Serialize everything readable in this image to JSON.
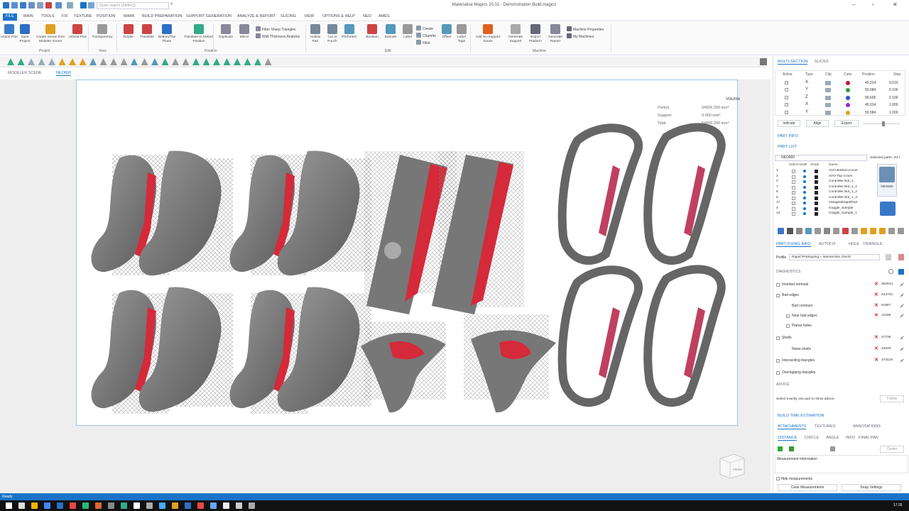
{
  "window": {
    "title": "Materialise Magics 25.02 - Demonstration Build.magics",
    "search_placeholder": "Quick search (Shift+Q)"
  },
  "menu": [
    "FILE",
    "MAIN",
    "TOOLS",
    "FIX",
    "TEXTURE",
    "POSITION",
    "MARK",
    "BUILD PREPARATION",
    "SUPPORT GENERATION",
    "ANALYZE & REPORT",
    "SLICING",
    "VIEW",
    "OPTIONS & HELP",
    "NEO",
    "AMES"
  ],
  "ribbon": {
    "project": [
      "Import Part",
      "Save Project",
      "Create Scene from Modeler Scene",
      "Unload Part"
    ],
    "project_label": "Project",
    "view": [
      "Transparency"
    ],
    "view_label": "View",
    "position": [
      "Rotate",
      "Translate",
      "Bottom/Top Plane",
      "Translate to Default Position"
    ],
    "position_label": "Position",
    "edit_big": [
      "Duplicate",
      "Mirror"
    ],
    "edit_small": [
      "Filter Sharp Triangles",
      "Wall Thickness Analysis"
    ],
    "edit2": [
      "Hollow Part",
      "Cut or Punch",
      "Perforator",
      "Boolean",
      "Extrude",
      "Label"
    ],
    "edit_small2": [
      "Create",
      "Chamfer",
      "Fillet"
    ],
    "edit3": [
      "Offset",
      "Label Tags"
    ],
    "edit_label": "Edit",
    "machine": [
      "Add No-Support Zones",
      "Generate Support",
      "Export Platform",
      "Generate Report"
    ],
    "machine_small": [
      "Machine Properties",
      "My Machines"
    ],
    "machine_label": "Machine"
  },
  "scene_tabs": [
    "MODELER SCENE",
    "NEO800"
  ],
  "volume": {
    "header": "Volume",
    "rows": [
      {
        "label": "Part(s)",
        "value": "54006.200 mm³"
      },
      {
        "label": "Support",
        "value": "0.000 mm³"
      },
      {
        "label": "Total",
        "value": "54006.200 mm³"
      }
    ]
  },
  "cube_label": "FRONT",
  "status": "Ready",
  "clock": "17:26",
  "panel": {
    "tabs": [
      "MULTI-SECTION",
      "SLICES"
    ],
    "section_headers": [
      "Active",
      "Type",
      "Clip",
      "Color",
      "Position",
      "Step"
    ],
    "sections": [
      {
        "type": "X",
        "color": "#c0143c",
        "position": "45.014",
        "step": "0.010"
      },
      {
        "type": "Y",
        "color": "#2a9d3a",
        "position": "50.584",
        "step": "0.100"
      },
      {
        "type": "Z",
        "color": "#2b4fd8",
        "position": "90.605",
        "step": "0.100"
      },
      {
        "type": "X",
        "color": "#9a2bc8",
        "position": "45.014",
        "step": "1.000"
      },
      {
        "type": "Y",
        "color": "#e0a020",
        "position": "50.584",
        "step": "1.000"
      }
    ],
    "section_buttons": [
      "Indicate",
      "Align",
      "Export"
    ],
    "part_info": "PART INFO",
    "part_list": "PART LIST",
    "machine": "NEO800",
    "selected": "Selected parts: 2/17",
    "list_headers": [
      "Select",
      "Visibl",
      "Shadi",
      "Name"
    ],
    "parts": [
      {
        "n": "1",
        "name": "AVO-Bottom-Cover"
      },
      {
        "n": "2",
        "name": "AVO-Top-Cover"
      },
      {
        "n": "3",
        "name": "Controller Bot_1"
      },
      {
        "n": "7",
        "name": "Controller Bot_1_1"
      },
      {
        "n": "8",
        "name": "Controller Bot_1_2"
      },
      {
        "n": "9",
        "name": "Controller Bot_1_3"
      },
      {
        "n": "17",
        "name": "eStageMergedPart"
      },
      {
        "n": "4",
        "name": "Goggle_Sample"
      },
      {
        "n": "14",
        "name": "Goggle_Sample_1"
      }
    ],
    "thumb_label": "NEO800",
    "fix_tabs": [
      "PART FIXING INFO",
      "AUTOFIX",
      "HOLE",
      "TRIANGLE"
    ],
    "profile_label": "Profile",
    "profile_value": "Rapid Prototyping + intersection check*",
    "diagnostics": "DIAGNOSTICS",
    "diag": [
      {
        "label": "Inverted normals",
        "value": "302844",
        "indent": 0
      },
      {
        "label": "Bad edges",
        "value": "543702",
        "indent": 0
      },
      {
        "label": "Bad contours",
        "value": "91967",
        "indent": 1
      },
      {
        "label": "Near bad edges",
        "value": "12166",
        "indent": 1
      },
      {
        "label": "Planar holes",
        "value": "",
        "indent": 1
      },
      {
        "label": "Shells",
        "value": "27738",
        "indent": 0
      },
      {
        "label": "Noise shells",
        "value": "22833",
        "indent": 1
      },
      {
        "label": "Intersecting triangles",
        "value": "373419",
        "indent": 0
      },
      {
        "label": "Overlapping triangles",
        "value": "",
        "indent": 0
      }
    ],
    "advice": "ADVICE",
    "advice_text": "Select exactly one part to show advice.",
    "follow": "Follow",
    "build_time": "BUILD TIME ESTIMATION",
    "attach_tabs": [
      "ATTACHMENTS",
      "TEXTURES",
      "ANNOTATIONS"
    ],
    "measure_tabs": [
      "DISTANCE",
      "CIRCLE",
      "ANGLE",
      "INFO",
      "FINAL PAR"
    ],
    "center": "Center",
    "measure_info": "Measurement Information",
    "hide_measure": "Hide measurements",
    "clear_btn": "Clear Measurements",
    "snap_btn": "Snap Settings"
  }
}
